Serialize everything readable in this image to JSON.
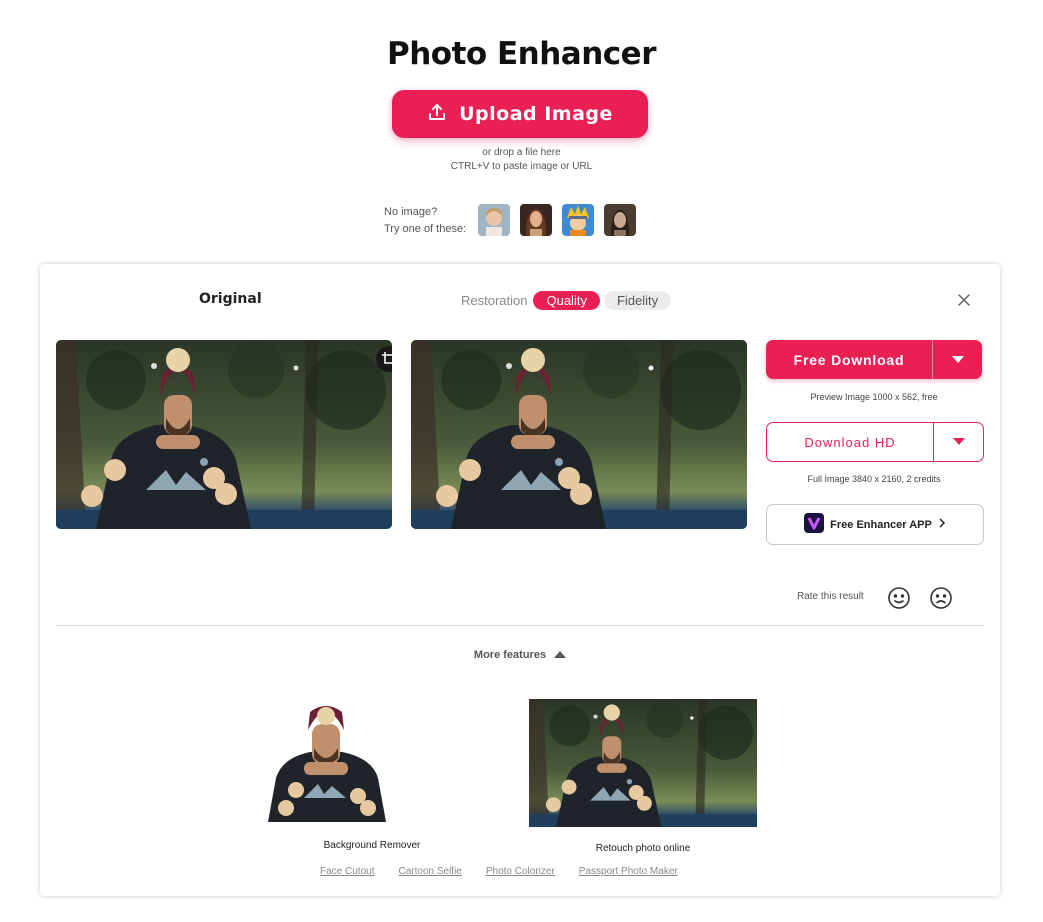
{
  "header": {
    "title": "Photo Enhancer",
    "upload_label": "Upload Image",
    "hint_line1": "or drop a file here",
    "hint_line2": "CTRL+V to paste image or URL",
    "samples_line1": "No image?",
    "samples_line2": "Try one of these:"
  },
  "result": {
    "original_label": "Original",
    "mode_label": "Restoration",
    "modes": [
      "Quality",
      "Fidelity"
    ],
    "active_mode": "Quality",
    "free_download_label": "Free Download",
    "free_download_note": "Preview Image 1000 x 562, free",
    "download_hd_label": "Download HD",
    "download_hd_note": "Full Image 3840 x 2160, 2 credits",
    "app_label": "Free Enhancer APP",
    "rate_label": "Rate this result"
  },
  "features": {
    "toggle_label": "More features",
    "items": [
      "Background Remover",
      "Retouch photo online"
    ],
    "links": [
      "Face Cutout",
      "Cartoon Selfie",
      "Photo Colorizer",
      "Passport Photo Maker"
    ]
  },
  "colors": {
    "accent": "#ea2055"
  }
}
